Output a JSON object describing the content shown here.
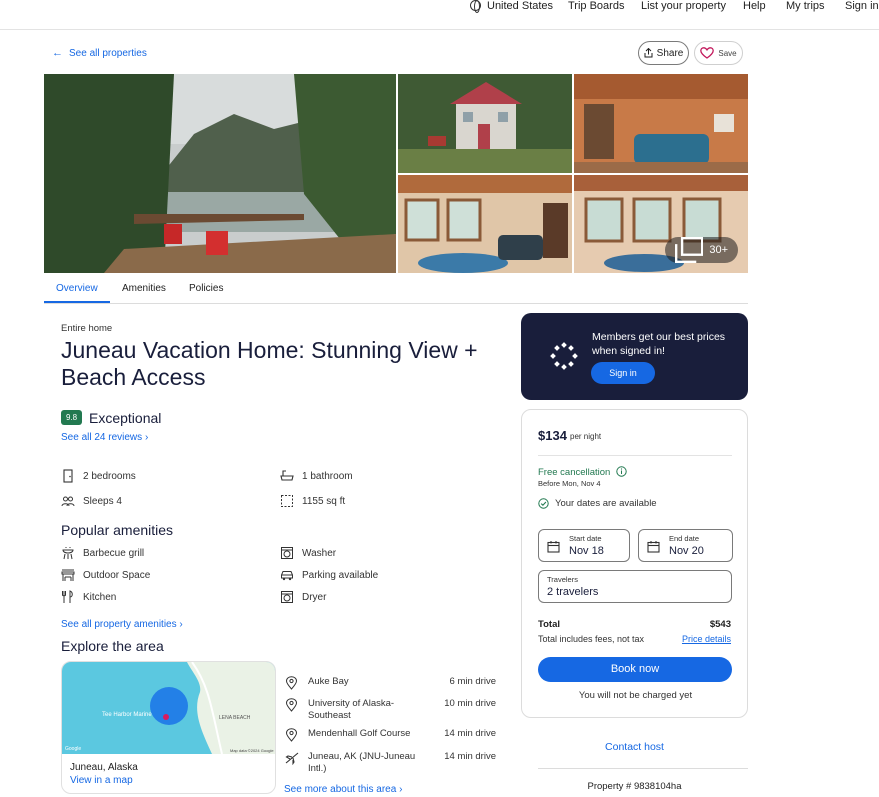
{
  "nav": {
    "region": "United States",
    "trip_boards": "Trip Boards",
    "list_property": "List your property",
    "help": "Help",
    "my_trips": "My trips",
    "sign_in": "Sign in"
  },
  "back_link": "See all properties",
  "share_label": "Share",
  "save_label": "Save",
  "gallery": {
    "more_photos": "30+"
  },
  "tabs": [
    "Overview",
    "Amenities",
    "Policies"
  ],
  "property": {
    "type": "Entire home",
    "title": "Juneau Vacation Home: Stunning View + Beach Access",
    "rating": "9.8",
    "rating_word": "Exceptional",
    "reviews_link": "See all 24 reviews",
    "features": {
      "bedrooms": "2 bedrooms",
      "bathroom": "1 bathroom",
      "sleeps": "Sleeps 4",
      "size": "1155 sq ft"
    }
  },
  "amenities": {
    "heading": "Popular amenities",
    "items": [
      "Barbecue grill",
      "Washer",
      "Outdoor Space",
      "Parking available",
      "Kitchen",
      "Dryer"
    ],
    "see_all": "See all property amenities"
  },
  "area": {
    "heading": "Explore the area",
    "map_city": "Juneau, Alaska",
    "map_view": "View in a map",
    "map_label_left": "Tee Harbor Marine",
    "map_label_right": "LENA BEACH",
    "map_google": "Google",
    "map_credit": "Map data ©2024 Google",
    "pois": [
      {
        "name": "Auke Bay",
        "time": "6 min drive"
      },
      {
        "name": "University of Alaska-Southeast",
        "time": "10 min drive"
      },
      {
        "name": "Mendenhall Golf Course",
        "time": "14 min drive"
      },
      {
        "name": "Juneau, AK (JNU-Juneau Intl.)",
        "time": "14 min drive"
      }
    ],
    "see_more": "See more about this area"
  },
  "promo": {
    "message": "Members get our best prices when signed in!",
    "button": "Sign in"
  },
  "pricing": {
    "price": "$134",
    "per": "per night",
    "free_cancel": "Free cancellation",
    "cancel_before": "Before Mon, Nov 4",
    "availability": "Your dates are available",
    "start_label": "Start date",
    "start_value": "Nov 18",
    "end_label": "End date",
    "end_value": "Nov 20",
    "travelers_label": "Travelers",
    "travelers_value": "2 travelers",
    "total_label": "Total",
    "total_value": "$543",
    "total_note": "Total includes fees, not tax",
    "price_details": "Price details",
    "book": "Book now",
    "not_charged": "You will not be charged yet"
  },
  "contact_host": "Contact host",
  "property_number": "Property # 9838104ha",
  "colors": {
    "accent": "#1668e3",
    "dark": "#191e3b",
    "rating_green": "#227950",
    "success_green": "#227950"
  }
}
